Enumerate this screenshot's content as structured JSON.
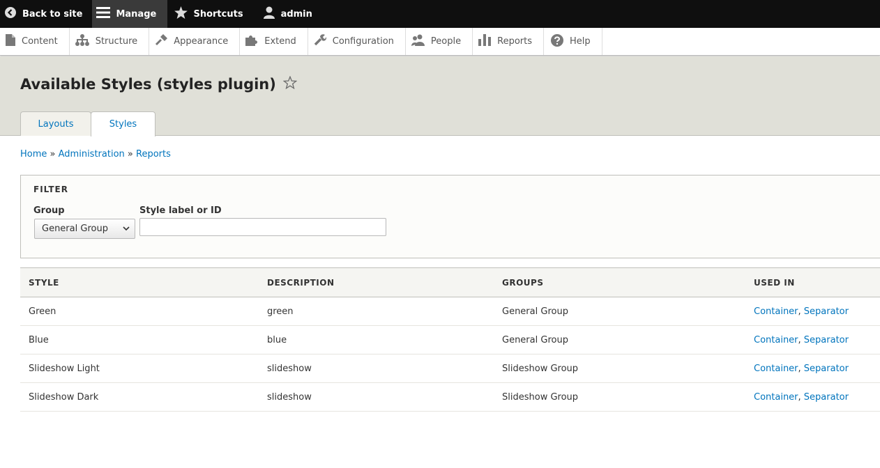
{
  "toolbar": {
    "back_label": "Back to site",
    "manage_label": "Manage",
    "shortcuts_label": "Shortcuts",
    "user_label": "admin"
  },
  "tray": {
    "items": [
      {
        "label": "Content",
        "icon": "file-icon"
      },
      {
        "label": "Structure",
        "icon": "sitemap-icon"
      },
      {
        "label": "Appearance",
        "icon": "brush-icon"
      },
      {
        "label": "Extend",
        "icon": "puzzle-icon"
      },
      {
        "label": "Configuration",
        "icon": "wrench-icon"
      },
      {
        "label": "People",
        "icon": "people-icon"
      },
      {
        "label": "Reports",
        "icon": "bar-chart-icon"
      },
      {
        "label": "Help",
        "icon": "help-icon"
      }
    ]
  },
  "page": {
    "title": "Available Styles (styles plugin)",
    "tabs": [
      {
        "label": "Layouts",
        "active": false
      },
      {
        "label": "Styles",
        "active": true
      }
    ]
  },
  "breadcrumb": {
    "items": [
      "Home",
      "Administration",
      "Reports"
    ],
    "separator": "»"
  },
  "filter": {
    "title": "FILTER",
    "group_label": "Group",
    "group_value": "General Group",
    "style_label": "Style label or ID",
    "style_value": ""
  },
  "table": {
    "headers": [
      "STYLE",
      "DESCRIPTION",
      "GROUPS",
      "USED IN"
    ],
    "rows": [
      {
        "style": "Green",
        "description": "green",
        "groups": "General Group",
        "used_in": [
          "Container",
          "Separator"
        ]
      },
      {
        "style": "Blue",
        "description": "blue",
        "groups": "General Group",
        "used_in": [
          "Container",
          "Separator"
        ]
      },
      {
        "style": "Slideshow Light",
        "description": "slideshow",
        "groups": "Slideshow Group",
        "used_in": [
          "Container",
          "Separator"
        ]
      },
      {
        "style": "Slideshow Dark",
        "description": "slideshow",
        "groups": "Slideshow Group",
        "used_in": [
          "Container",
          "Separator"
        ]
      }
    ],
    "used_in_separator": ", "
  },
  "colors": {
    "link": "#0074bd",
    "toolbar_bg": "#0f0f0f",
    "header_bg": "#e0e0d8"
  }
}
